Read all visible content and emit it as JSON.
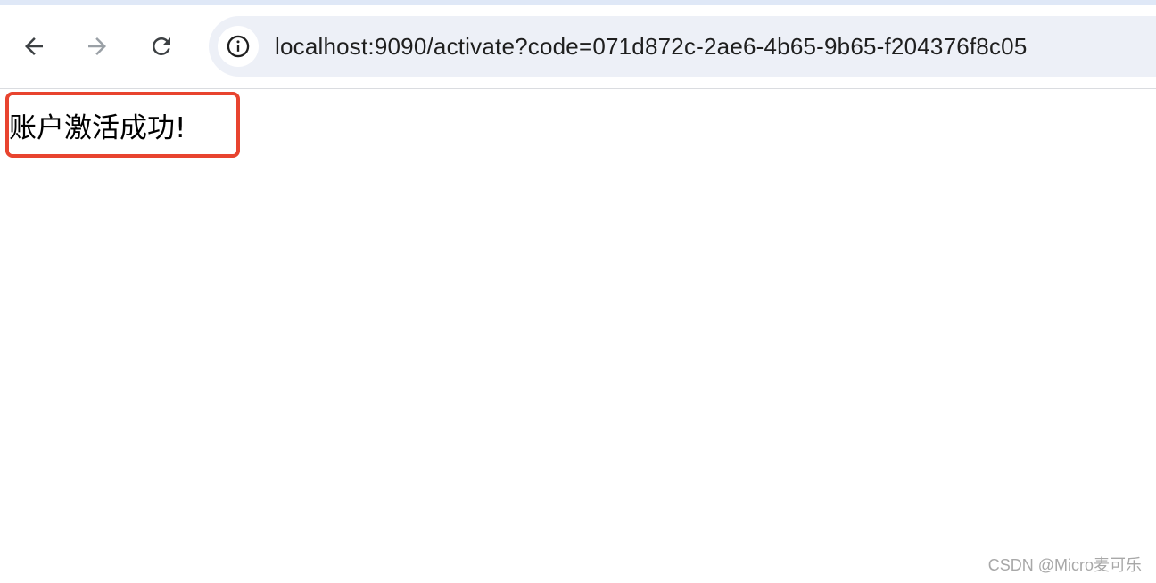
{
  "browser": {
    "url": "localhost:9090/activate?code=071d872c-2ae6-4b65-9b65-f204376f8c05",
    "icons": {
      "back": "arrow-left-icon",
      "forward": "arrow-right-icon",
      "reload": "reload-icon",
      "site_info": "info-icon"
    },
    "colors": {
      "omnibox_bg": "#edf0f7",
      "top_strip": "#dfe8f7",
      "forward_disabled": "#9aa0a6",
      "nav_icon": "#3c4043"
    }
  },
  "page": {
    "message": "账户激活成功!",
    "highlight_color": "#e8442f"
  },
  "watermark": {
    "text": "CSDN @Micro麦可乐"
  }
}
